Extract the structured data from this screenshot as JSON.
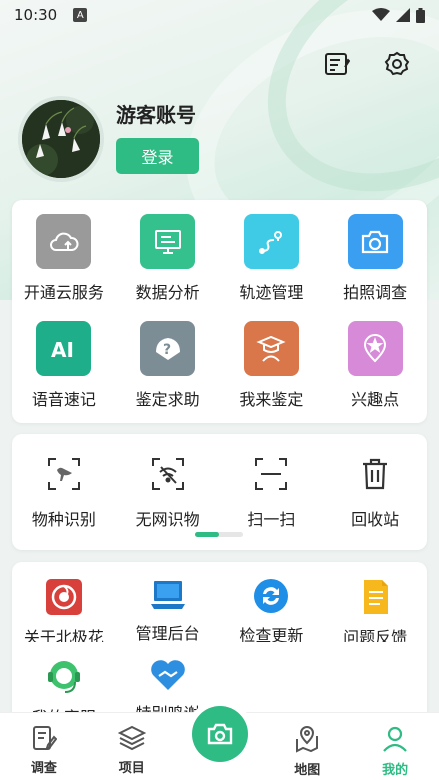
{
  "status": {
    "time": "10:30",
    "notice": "A"
  },
  "profile": {
    "name": "游客账号",
    "login_label": "登录"
  },
  "tools": [
    {
      "label": "开通云服务",
      "icon": "cloud-icon",
      "color": "#9a9a9a"
    },
    {
      "label": "数据分析",
      "icon": "chart-board-icon",
      "color": "#35c18e"
    },
    {
      "label": "轨迹管理",
      "icon": "route-icon",
      "color": "#3fcbe6"
    },
    {
      "label": "拍照调查",
      "icon": "camera-icon",
      "color": "#3a9ff0"
    },
    {
      "label": "语音速记",
      "icon": "ai-icon",
      "color": "#1fae8a"
    },
    {
      "label": "鉴定求助",
      "icon": "help-leaf-icon",
      "color": "#7d8d96"
    },
    {
      "label": "我来鉴定",
      "icon": "expert-icon",
      "color": "#d9764a"
    },
    {
      "label": "兴趣点",
      "icon": "poi-icon",
      "color": "#d78ad8"
    }
  ],
  "quick": [
    {
      "label": "物种识别",
      "icon": "bird-scan-icon"
    },
    {
      "label": "无网识物",
      "icon": "offline-scan-icon"
    },
    {
      "label": "扫一扫",
      "icon": "scan-icon"
    },
    {
      "label": "回收站",
      "icon": "trash-icon"
    }
  ],
  "more": [
    {
      "label": "关于北极花",
      "icon": "flower-logo-icon"
    },
    {
      "label": "管理后台",
      "icon": "laptop-icon"
    },
    {
      "label": "检查更新",
      "icon": "update-icon"
    },
    {
      "label": "问题反馈",
      "icon": "feedback-doc-icon"
    },
    {
      "label": "我的客服",
      "icon": "service-icon"
    },
    {
      "label": "特别鸣谢",
      "icon": "thanks-heart-icon"
    }
  ],
  "tabs": [
    {
      "label": "调查",
      "icon": "survey-icon"
    },
    {
      "label": "项目",
      "icon": "layers-icon"
    },
    {
      "label": "",
      "icon": "camera-icon"
    },
    {
      "label": "地图",
      "icon": "map-icon"
    },
    {
      "label": "我的",
      "icon": "user-icon",
      "active": true
    }
  ],
  "colors": {
    "accent": "#2fbb84"
  }
}
